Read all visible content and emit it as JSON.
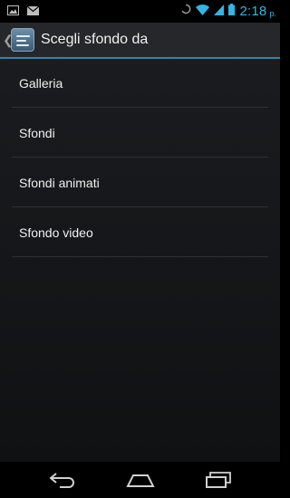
{
  "status_bar": {
    "time": "2:18",
    "ampm": "p.",
    "icons": [
      "picture-icon",
      "gmail-icon",
      "sync-icon",
      "wifi-icon",
      "signal-icon",
      "battery-icon"
    ]
  },
  "action_bar": {
    "title": "Scegli sfondo da",
    "icon": "wallpaper-settings-icon"
  },
  "list": {
    "items": [
      {
        "label": "Galleria"
      },
      {
        "label": "Sfondi"
      },
      {
        "label": "Sfondi animati"
      },
      {
        "label": "Sfondo video"
      }
    ]
  },
  "nav_bar": {
    "buttons": [
      "back-icon",
      "home-icon",
      "recents-icon"
    ]
  },
  "colors": {
    "accent": "#33b5e5",
    "action_bar_line": "#2e86b0",
    "text": "#f0f0f0"
  }
}
